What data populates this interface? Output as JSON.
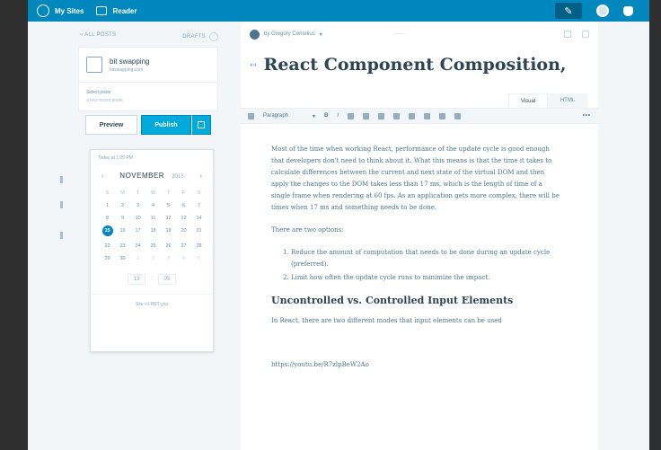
{
  "masterbar": {
    "my_sites": "My Sites",
    "reader": "Reader"
  },
  "sidebar": {
    "all_posts": "« ALL POSTS",
    "drafts": "DRAFTS",
    "site_name": "bit swapping",
    "site_url": "bitswapping.com",
    "select_line1": "Select posts",
    "select_line2": "a few recent posts",
    "preview": "Preview",
    "publish": "Publish"
  },
  "calendar": {
    "date_label": "Today at 1:05 PM",
    "month": "NOVEMBER",
    "year": "2015",
    "weekdays": [
      "S",
      "M",
      "T",
      "W",
      "T",
      "F",
      "S"
    ],
    "days": [
      [
        "1",
        "2",
        "3",
        "4",
        "5",
        "6",
        "7"
      ],
      [
        "8",
        "9",
        "10",
        "11",
        "12",
        "13",
        "14"
      ],
      [
        "15",
        "16",
        "17",
        "18",
        "19",
        "20",
        "21"
      ],
      [
        "22",
        "23",
        "24",
        "25",
        "26",
        "27",
        "28"
      ],
      [
        "29",
        "30",
        "1",
        "2",
        "3",
        "4",
        "5"
      ]
    ],
    "selected_day": "15",
    "hour": "13",
    "minute": "05",
    "timezone": "Site +1 PST-you"
  },
  "editor": {
    "author": "by Gregory Cornelius",
    "title": "React Component Composition, t",
    "tab_visual": "Visual",
    "tab_html": "HTML",
    "format": "Paragraph",
    "para1": "Most of the time when working React, performance of the update cycle is good enough that developers don't need to think about it. What this means is that the time it takes to calculate differences between the current and next state of the virtual DOM and then apply the changes to the DOM takes less than 17 ms, which is the length of time of a single frame when rendering at 60 fps. As an application gets more complex, there will be times when 17 ms and something needs to be done.",
    "para2": "There are two options:",
    "li1": "Reduce the amount of computation that needs to be done during an update cycle (preferred).",
    "li2": "Limit how often the update cycle runs to minimize the impact.",
    "heading": "Uncontrolled vs. Controlled Input Elements",
    "para3": "In React, there are two different modes that input elements can be used",
    "link": "https://youtu.be/R7zlpBeW2Ao"
  },
  "colors": {
    "masterbar": "#0087be",
    "publish": "#00aadc",
    "text": "#2e4453"
  }
}
